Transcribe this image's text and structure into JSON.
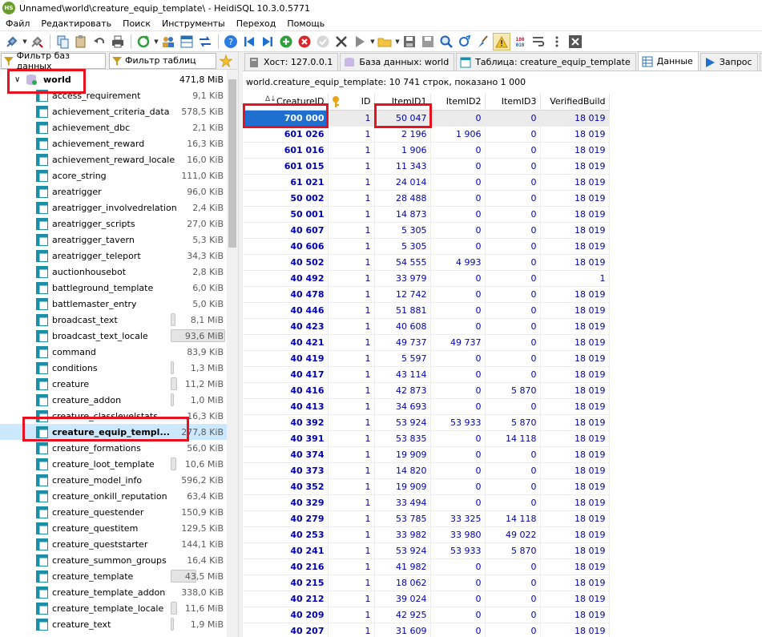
{
  "window": {
    "title": "Unnamed\\world\\creature_equip_template\\ - HeidiSQL 10.3.0.5771",
    "logo_text": "HS"
  },
  "menu": [
    "Файл",
    "Редактировать",
    "Поиск",
    "Инструменты",
    "Переход",
    "Помощь"
  ],
  "filters": {
    "db_filter_placeholder": "Фильтр баз данных",
    "table_filter_placeholder": "Фильтр таблиц"
  },
  "tree": {
    "database": {
      "name": "world",
      "size": "471,8 MiB"
    },
    "tables": [
      {
        "name": "access_requirement",
        "size": "9,1 KiB"
      },
      {
        "name": "achievement_criteria_data",
        "size": "578,5 KiB"
      },
      {
        "name": "achievement_dbc",
        "size": "2,1 KiB"
      },
      {
        "name": "achievement_reward",
        "size": "16,3 KiB"
      },
      {
        "name": "achievement_reward_locale",
        "size": "16,0 KiB"
      },
      {
        "name": "acore_string",
        "size": "111,0 KiB"
      },
      {
        "name": "areatrigger",
        "size": "96,0 KiB"
      },
      {
        "name": "areatrigger_involvedrelation",
        "size": "2,4 KiB"
      },
      {
        "name": "areatrigger_scripts",
        "size": "27,0 KiB"
      },
      {
        "name": "areatrigger_tavern",
        "size": "5,3 KiB"
      },
      {
        "name": "areatrigger_teleport",
        "size": "34,3 KiB"
      },
      {
        "name": "auctionhousebot",
        "size": "2,8 KiB"
      },
      {
        "name": "battleground_template",
        "size": "6,0 KiB"
      },
      {
        "name": "battlemaster_entry",
        "size": "5,0 KiB"
      },
      {
        "name": "broadcast_text",
        "size": "8,1 MiB"
      },
      {
        "name": "broadcast_text_locale",
        "size": "93,6 MiB"
      },
      {
        "name": "command",
        "size": "83,9 KiB"
      },
      {
        "name": "conditions",
        "size": "1,3 MiB"
      },
      {
        "name": "creature",
        "size": "11,2 MiB"
      },
      {
        "name": "creature_addon",
        "size": "1,0 MiB"
      },
      {
        "name": "creature_classlevelstats",
        "size": "16,3 KiB"
      },
      {
        "name": "creature_equip_templ...",
        "size": "277,8 KiB"
      },
      {
        "name": "creature_formations",
        "size": "56,0 KiB"
      },
      {
        "name": "creature_loot_template",
        "size": "10,6 MiB"
      },
      {
        "name": "creature_model_info",
        "size": "596,2 KiB"
      },
      {
        "name": "creature_onkill_reputation",
        "size": "63,4 KiB"
      },
      {
        "name": "creature_questender",
        "size": "150,9 KiB"
      },
      {
        "name": "creature_questitem",
        "size": "129,5 KiB"
      },
      {
        "name": "creature_queststarter",
        "size": "144,1 KiB"
      },
      {
        "name": "creature_summon_groups",
        "size": "16,4 KiB"
      },
      {
        "name": "creature_template",
        "size": "43,5 MiB"
      },
      {
        "name": "creature_template_addon",
        "size": "338,0 KiB"
      },
      {
        "name": "creature_template_locale",
        "size": "11,6 MiB"
      },
      {
        "name": "creature_text",
        "size": "1,9 MiB"
      }
    ],
    "size_bars": [
      {
        "row": 14,
        "fraction": 0.09
      },
      {
        "row": 15,
        "fraction": 1.0
      },
      {
        "row": 17,
        "fraction": 0.03
      },
      {
        "row": 18,
        "fraction": 0.12
      },
      {
        "row": 19,
        "fraction": 0.02
      },
      {
        "row": 23,
        "fraction": 0.11
      },
      {
        "row": 30,
        "fraction": 0.47
      },
      {
        "row": 32,
        "fraction": 0.12
      },
      {
        "row": 33,
        "fraction": 0.03
      }
    ],
    "selected_index": 21
  },
  "tabs": [
    {
      "label": "Хост: 127.0.0.1"
    },
    {
      "label": "База данных: world"
    },
    {
      "label": "Таблица: creature_equip_template"
    },
    {
      "label": "Данные"
    },
    {
      "label": "Запрос"
    }
  ],
  "info": "world.creature_equip_template: 10 741 строк, показано 1 000",
  "grid": {
    "columns": [
      "CreatureID",
      "ID",
      "ItemID1",
      "ItemID2",
      "ItemID3",
      "VerifiedBuild"
    ],
    "rows": [
      [
        "700 000",
        "1",
        "50 047",
        "0",
        "0",
        "18 019"
      ],
      [
        "601 026",
        "1",
        "2 196",
        "1 906",
        "0",
        "18 019"
      ],
      [
        "601 016",
        "1",
        "1 906",
        "0",
        "0",
        "18 019"
      ],
      [
        "601 015",
        "1",
        "11 343",
        "0",
        "0",
        "18 019"
      ],
      [
        "61 021",
        "1",
        "24 014",
        "0",
        "0",
        "18 019"
      ],
      [
        "50 002",
        "1",
        "28 488",
        "0",
        "0",
        "18 019"
      ],
      [
        "50 001",
        "1",
        "14 873",
        "0",
        "0",
        "18 019"
      ],
      [
        "40 607",
        "1",
        "5 305",
        "0",
        "0",
        "18 019"
      ],
      [
        "40 606",
        "1",
        "5 305",
        "0",
        "0",
        "18 019"
      ],
      [
        "40 502",
        "1",
        "54 555",
        "4 993",
        "0",
        "18 019"
      ],
      [
        "40 492",
        "1",
        "33 979",
        "0",
        "0",
        "1"
      ],
      [
        "40 478",
        "1",
        "12 742",
        "0",
        "0",
        "18 019"
      ],
      [
        "40 446",
        "1",
        "51 881",
        "0",
        "0",
        "18 019"
      ],
      [
        "40 423",
        "1",
        "40 608",
        "0",
        "0",
        "18 019"
      ],
      [
        "40 421",
        "1",
        "49 737",
        "49 737",
        "0",
        "18 019"
      ],
      [
        "40 419",
        "1",
        "5 597",
        "0",
        "0",
        "18 019"
      ],
      [
        "40 417",
        "1",
        "43 114",
        "0",
        "0",
        "18 019"
      ],
      [
        "40 416",
        "1",
        "42 873",
        "0",
        "5 870",
        "18 019"
      ],
      [
        "40 413",
        "1",
        "34 693",
        "0",
        "0",
        "18 019"
      ],
      [
        "40 392",
        "1",
        "53 924",
        "53 933",
        "5 870",
        "18 019"
      ],
      [
        "40 391",
        "1",
        "53 835",
        "0",
        "14 118",
        "18 019"
      ],
      [
        "40 374",
        "1",
        "19 909",
        "0",
        "0",
        "18 019"
      ],
      [
        "40 373",
        "1",
        "14 820",
        "0",
        "0",
        "18 019"
      ],
      [
        "40 352",
        "1",
        "19 909",
        "0",
        "0",
        "18 019"
      ],
      [
        "40 329",
        "1",
        "33 494",
        "0",
        "0",
        "18 019"
      ],
      [
        "40 279",
        "1",
        "53 785",
        "33 325",
        "14 118",
        "18 019"
      ],
      [
        "40 253",
        "1",
        "33 982",
        "33 980",
        "49 022",
        "18 019"
      ],
      [
        "40 241",
        "1",
        "53 924",
        "53 933",
        "5 870",
        "18 019"
      ],
      [
        "40 216",
        "1",
        "41 982",
        "0",
        "0",
        "18 019"
      ],
      [
        "40 215",
        "1",
        "18 062",
        "0",
        "0",
        "18 019"
      ],
      [
        "40 212",
        "1",
        "39 024",
        "0",
        "0",
        "18 019"
      ],
      [
        "40 209",
        "1",
        "42 925",
        "0",
        "0",
        "18 019"
      ],
      [
        "40 207",
        "1",
        "31 609",
        "0",
        "0",
        "18 019"
      ]
    ]
  },
  "colors": {
    "highlight_box": "#e8111f",
    "selected_cell": "#1f6fd0",
    "value_text": "#0000b0"
  }
}
